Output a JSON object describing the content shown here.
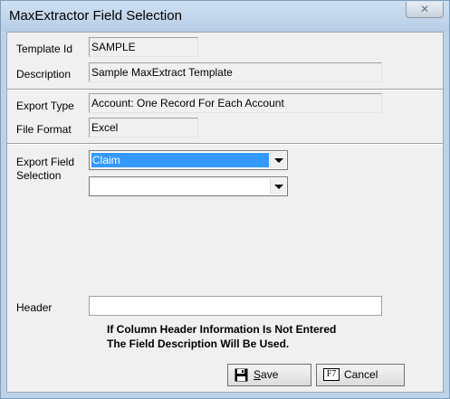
{
  "window": {
    "title": "MaxExtractor Field Selection",
    "close_glyph": "✕"
  },
  "form": {
    "template_id_label": "Template  Id",
    "template_id_value": "SAMPLE",
    "description_label": "Description",
    "description_value": "Sample MaxExtract Template",
    "export_type_label": "Export Type",
    "export_type_value": "Account: One Record For Each Account",
    "file_format_label": "File Format",
    "file_format_value": "Excel",
    "export_field_label_line1": "Export Field",
    "export_field_label_line2": "Selection",
    "export_field_1_value": "Claim",
    "export_field_2_value": "",
    "header_label": "Header",
    "header_value": "",
    "note_line1": "If Column Header Information Is Not Entered",
    "note_line2": "The Field Description Will Be Used."
  },
  "buttons": {
    "save_label": "Save",
    "save_icon": "floppy-disk-icon",
    "cancel_label": "Cancel",
    "cancel_shortcut": "F7"
  },
  "colors": {
    "selection": "#3399ff",
    "window_frame": "#bfd3e8",
    "client_bg": "#f0f0f0"
  }
}
